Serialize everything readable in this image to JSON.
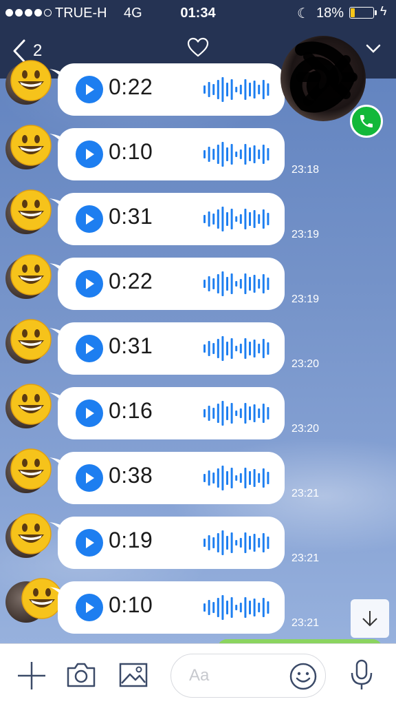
{
  "status_bar": {
    "carrier": "TRUE-H",
    "network": "4G",
    "time": "01:34",
    "battery_percent": "18%",
    "battery_level": 0.18,
    "battery_color": "#f5c518",
    "signal_bars_filled": 4,
    "signal_bars_total": 5,
    "icons": [
      "moon-icon",
      "battery-icon",
      "charging-bolt-icon"
    ]
  },
  "header": {
    "back_count": "2",
    "page_indicator": {
      "pages": 3,
      "active": 0
    },
    "icons": [
      "chevron-left-icon",
      "heart-icon",
      "chevron-down-icon"
    ]
  },
  "contact": {
    "icons": [
      "phone-icon"
    ],
    "call_badge_color": "#12b83a"
  },
  "messages": [
    {
      "duration": "0:22",
      "time": ""
    },
    {
      "duration": "0:10",
      "time": "23:18"
    },
    {
      "duration": "0:31",
      "time": "23:19"
    },
    {
      "duration": "0:22",
      "time": "23:19"
    },
    {
      "duration": "0:31",
      "time": "23:20"
    },
    {
      "duration": "0:16",
      "time": "23:20"
    },
    {
      "duration": "0:38",
      "time": "23:21"
    },
    {
      "duration": "0:19",
      "time": "23:21"
    },
    {
      "duration": "0:10",
      "time": "23:21"
    }
  ],
  "input_bar": {
    "placeholder": "Aa",
    "icons": [
      "plus-icon",
      "camera-icon",
      "image-icon",
      "emoji-icon",
      "microphone-icon"
    ]
  },
  "colors": {
    "header_bg": "#253353",
    "accent_blue": "#1d7ef0"
  }
}
